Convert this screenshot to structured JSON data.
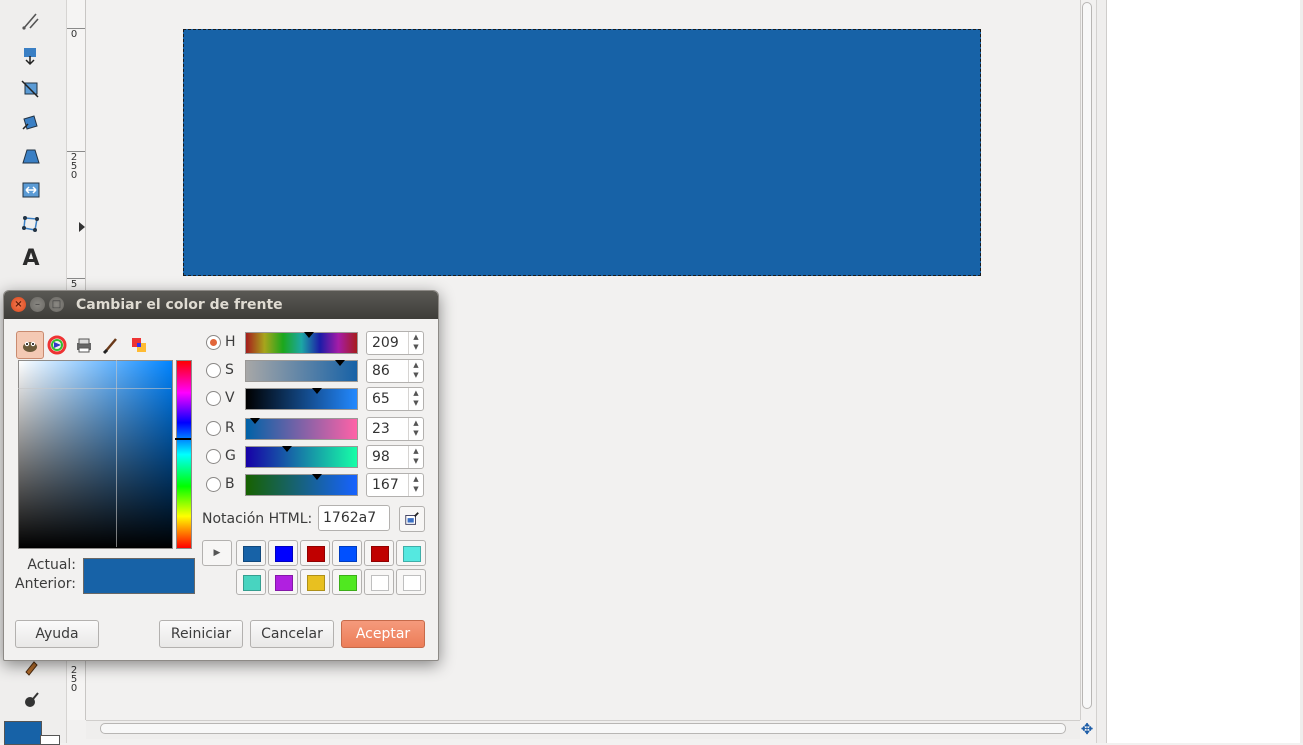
{
  "colors": {
    "current_color": "#1762a7",
    "previous_color": "#1762a7",
    "accent": "#e2663a"
  },
  "toolbox": {
    "tools": [
      "paths-icon",
      "align-icon",
      "crop-icon",
      "rotate-icon",
      "perspective-icon",
      "flip-icon",
      "cage-transform-icon",
      "text-icon"
    ],
    "bottom_tools": [
      "smudge-icon",
      "dodge-burn-icon"
    ]
  },
  "ruler": {
    "labels": [
      "0",
      "2\n5\n0",
      "5",
      "2\n5\n0"
    ]
  },
  "dialog": {
    "title": "Cambiar el color de frente",
    "selectors": [
      "gimp-selector-icon",
      "color-wheel-icon",
      "cmyk-printer-icon",
      "watercolor-brush-icon",
      "palette-icon"
    ],
    "current_label": "Actual:",
    "previous_label": "Anterior:",
    "channels": [
      {
        "label": "H",
        "value": "209",
        "selected": true
      },
      {
        "label": "S",
        "value": "86",
        "selected": false
      },
      {
        "label": "V",
        "value": "65",
        "selected": false
      },
      {
        "label": "R",
        "value": "23",
        "selected": false
      },
      {
        "label": "G",
        "value": "98",
        "selected": false
      },
      {
        "label": "B",
        "value": "167",
        "selected": false
      }
    ],
    "channel_levels": [
      0.58,
      0.86,
      0.65,
      0.09,
      0.38,
      0.65
    ],
    "html_label": "Notación HTML:",
    "html_value": "1762a7",
    "history": [
      "#1762a7",
      "#0000ff",
      "#c00000",
      "#0050ff",
      "#c00000",
      "#55e8e0",
      "#48d4c0",
      "#b020e0",
      "#e8c020",
      "#50e820",
      "#ffffff",
      "#ffffff"
    ],
    "buttons": {
      "help": "Ayuda",
      "reset": "Reiniciar",
      "cancel": "Cancelar",
      "ok": "Aceptar"
    }
  }
}
